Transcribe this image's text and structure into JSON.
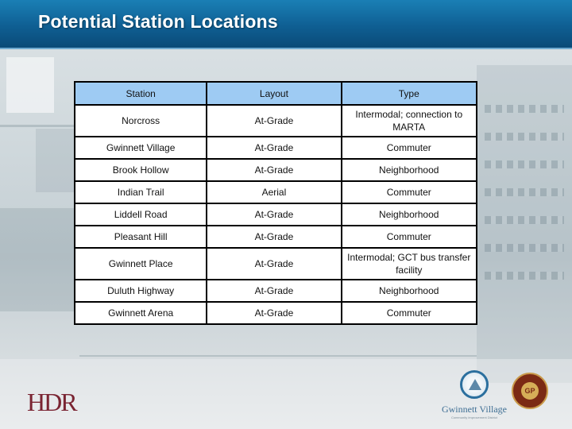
{
  "slide": {
    "title": "Potential Station Locations"
  },
  "table": {
    "headers": [
      "Station",
      "Layout",
      "Type"
    ],
    "rows": [
      {
        "station": "Norcross",
        "layout": "At-Grade",
        "type": "Intermodal; connection to MARTA"
      },
      {
        "station": "Gwinnett Village",
        "layout": "At-Grade",
        "type": "Commuter"
      },
      {
        "station": "Brook Hollow",
        "layout": "At-Grade",
        "type": "Neighborhood"
      },
      {
        "station": "Indian Trail",
        "layout": "Aerial",
        "type": "Commuter"
      },
      {
        "station": "Liddell Road",
        "layout": "At-Grade",
        "type": "Neighborhood"
      },
      {
        "station": "Pleasant Hill",
        "layout": "At-Grade",
        "type": "Commuter"
      },
      {
        "station": "Gwinnett Place",
        "layout": "At-Grade",
        "type": "Intermodal; GCT bus transfer facility"
      },
      {
        "station": "Duluth Highway",
        "layout": "At-Grade",
        "type": "Neighborhood"
      },
      {
        "station": "Gwinnett Arena",
        "layout": "At-Grade",
        "type": "Commuter"
      }
    ]
  },
  "logos": {
    "hdr": "HDR",
    "gwinnett_village": "Gwinnett Village",
    "gwinnett_village_tagline": "Community Improvement District",
    "gwinnett_place": "GP"
  },
  "colors": {
    "title_bar": "#0f5f93",
    "table_header": "#9ecbf3",
    "hdr_logo": "#7a2432"
  }
}
